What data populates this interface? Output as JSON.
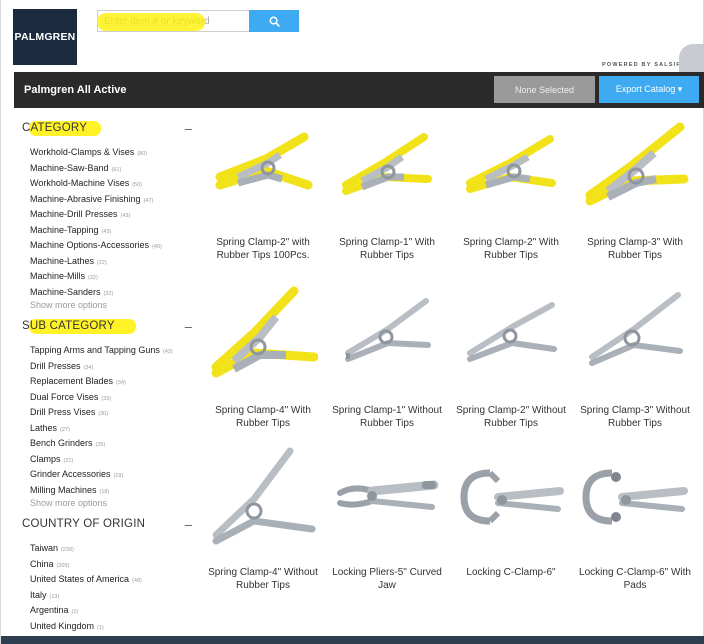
{
  "header": {
    "logo_text": "PALMGREN",
    "search_placeholder": "Enter item # or keyword",
    "powered_by": "POWERED BY SALSIFY"
  },
  "titlebar": {
    "title": "Palmgren All Active",
    "selection_label": "None Selected",
    "export_label": "Export Catalog ▾"
  },
  "sidebar": {
    "category": {
      "title": "CATEGORY",
      "items": [
        {
          "label": "Workhold-Clamps & Vises",
          "count": "(80)"
        },
        {
          "label": "Machine-Saw-Band",
          "count": "(61)"
        },
        {
          "label": "Workhold-Machine Vises",
          "count": "(50)"
        },
        {
          "label": "Machine-Abrasive Finishing",
          "count": "(47)"
        },
        {
          "label": "Machine-Drill Presses",
          "count": "(43)"
        },
        {
          "label": "Machine-Tapping",
          "count": "(43)"
        },
        {
          "label": "Machine Options-Accessories",
          "count": "(40)"
        },
        {
          "label": "Machine-Lathes",
          "count": "(22)"
        },
        {
          "label": "Machine-Mills",
          "count": "(22)"
        },
        {
          "label": "Machine-Sanders",
          "count": "(22)"
        }
      ],
      "show_more": "Show more options"
    },
    "subcategory": {
      "title": "SUB CATEGORY",
      "items": [
        {
          "label": "Tapping Arms and Tapping Guns",
          "count": "(43)"
        },
        {
          "label": "Drill Presses",
          "count": "(34)"
        },
        {
          "label": "Replacement Blades",
          "count": "(34)"
        },
        {
          "label": "Dual Force Vises",
          "count": "(33)"
        },
        {
          "label": "Drill Press Vises",
          "count": "(30)"
        },
        {
          "label": "Lathes",
          "count": "(27)"
        },
        {
          "label": "Bench Grinders",
          "count": "(25)"
        },
        {
          "label": "Clamps",
          "count": "(21)"
        },
        {
          "label": "Grinder Accessories",
          "count": "(19)"
        },
        {
          "label": "Milling Machines",
          "count": "(18)"
        }
      ],
      "show_more": "Show more options"
    },
    "country": {
      "title": "COUNTRY OF ORIGIN",
      "items": [
        {
          "label": "Taiwan",
          "count": "(230)"
        },
        {
          "label": "China",
          "count": "(205)"
        },
        {
          "label": "United States of America",
          "count": "(48)"
        },
        {
          "label": "Italy",
          "count": "(13)"
        },
        {
          "label": "Argentina",
          "count": "(1)"
        },
        {
          "label": "United Kingdom",
          "count": "(1)"
        }
      ]
    },
    "collapse_icon": "minus-icon"
  },
  "products": [
    {
      "name": "Spring Clamp-2\" with Rubber Tips 100Pcs.",
      "icon": "spring-clamp-yellow"
    },
    {
      "name": "Spring Clamp-1\" With Rubber Tips",
      "icon": "spring-clamp-yellow"
    },
    {
      "name": "Spring Clamp-2\" With Rubber Tips",
      "icon": "spring-clamp-yellow"
    },
    {
      "name": "Spring Clamp-3\" With Rubber Tips",
      "icon": "spring-clamp-yellow"
    },
    {
      "name": "Spring Clamp-4\" With Rubber Tips",
      "icon": "spring-clamp-yellow"
    },
    {
      "name": "Spring Clamp-1\" Without Rubber Tips",
      "icon": "spring-clamp-bare"
    },
    {
      "name": "Spring Clamp-2\" Without Rubber Tips",
      "icon": "spring-clamp-bare"
    },
    {
      "name": "Spring Clamp-3\" Without Rubber Tips",
      "icon": "spring-clamp-bare"
    },
    {
      "name": "Spring Clamp-4\" Without Rubber Tips",
      "icon": "spring-clamp-bare"
    },
    {
      "name": "Locking Pliers-5\" Curved Jaw",
      "icon": "locking-pliers"
    },
    {
      "name": "Locking C-Clamp-6\"",
      "icon": "locking-c-clamp"
    },
    {
      "name": "Locking C-Clamp-6\" With Pads",
      "icon": "locking-c-clamp-pads"
    }
  ],
  "colors": {
    "accent": "#3eaaf2",
    "titlebar": "#2a2a2a",
    "highlight": "#fff000",
    "rubber_tip": "#f2e21a",
    "metal": "#b8bec4"
  }
}
